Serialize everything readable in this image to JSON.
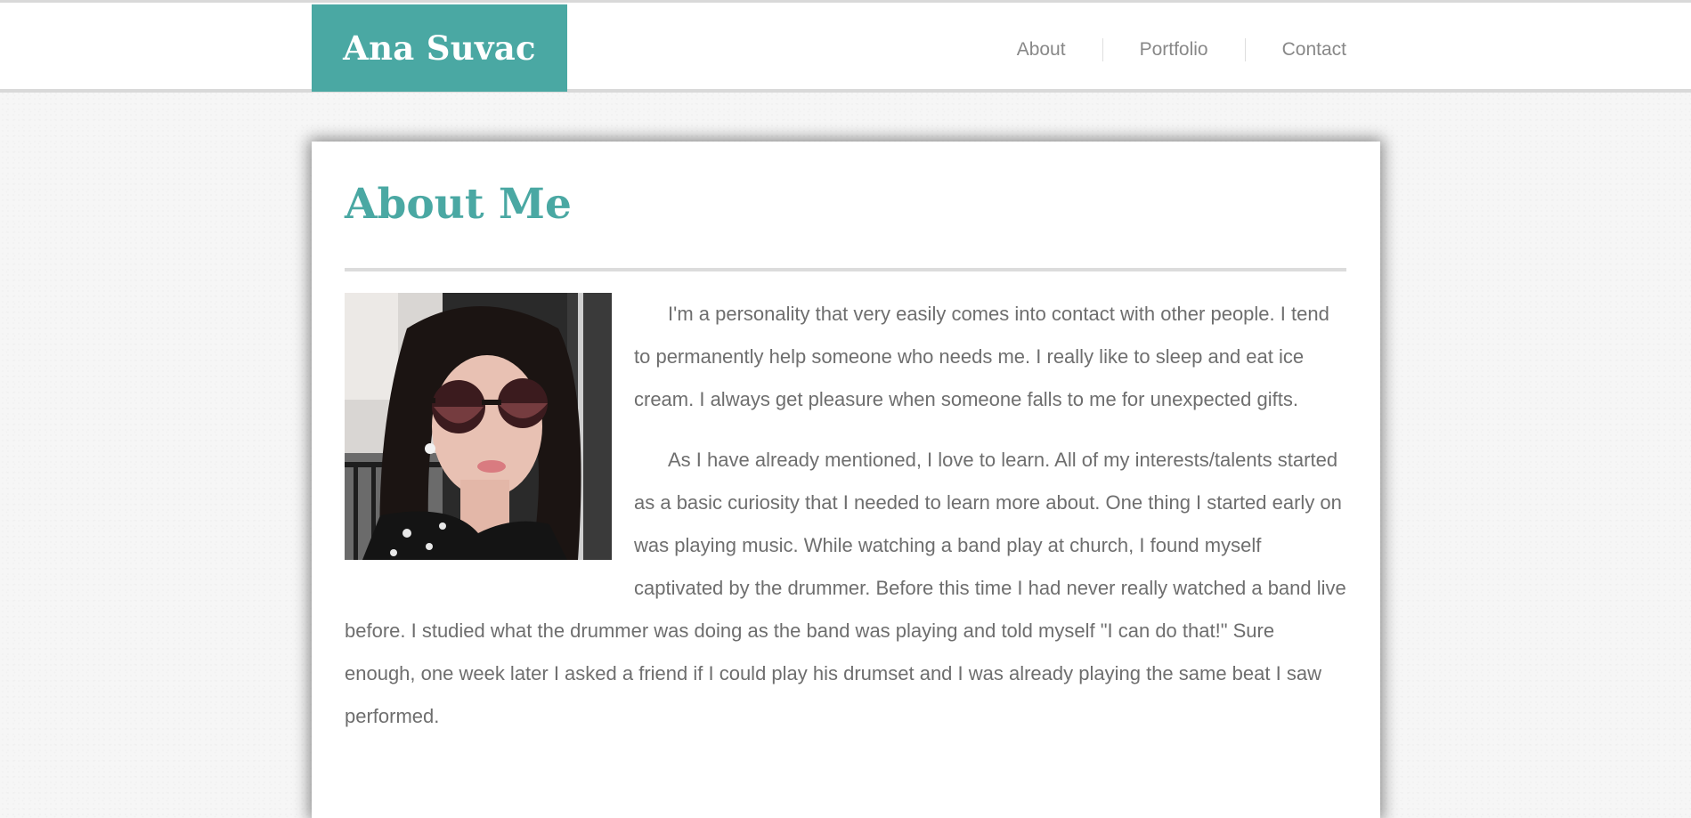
{
  "header": {
    "logo_text": "Ana Suvac",
    "nav": [
      {
        "label": "About"
      },
      {
        "label": "Portfolio"
      },
      {
        "label": "Contact"
      }
    ]
  },
  "main": {
    "title": "About Me",
    "photo_icon": "portrait-photo",
    "paragraphs": [
      "I'm a personality that very easily comes into contact with other people. I tend to permanently help someone who needs me. I really like to sleep and eat ice cream. I always get pleasure when someone falls to me for unexpected gifts.",
      "As I have already mentioned, I love to learn. All of my interests/talents started as a basic curiosity that I needed to learn more about. One thing I started early on was playing music. While watching a band play at church, I found myself captivated by the drummer. Before this time I had never really watched a band live before. I studied what the drummer was doing as the band was playing and told myself \"I can do that!\" Sure enough, one week later I asked a friend if I could play his drumset and I was already playing the same beat I saw performed."
    ]
  },
  "colors": {
    "accent": "#4aa8a3",
    "nav_text": "#888888",
    "body_text": "#6e6e6e"
  }
}
